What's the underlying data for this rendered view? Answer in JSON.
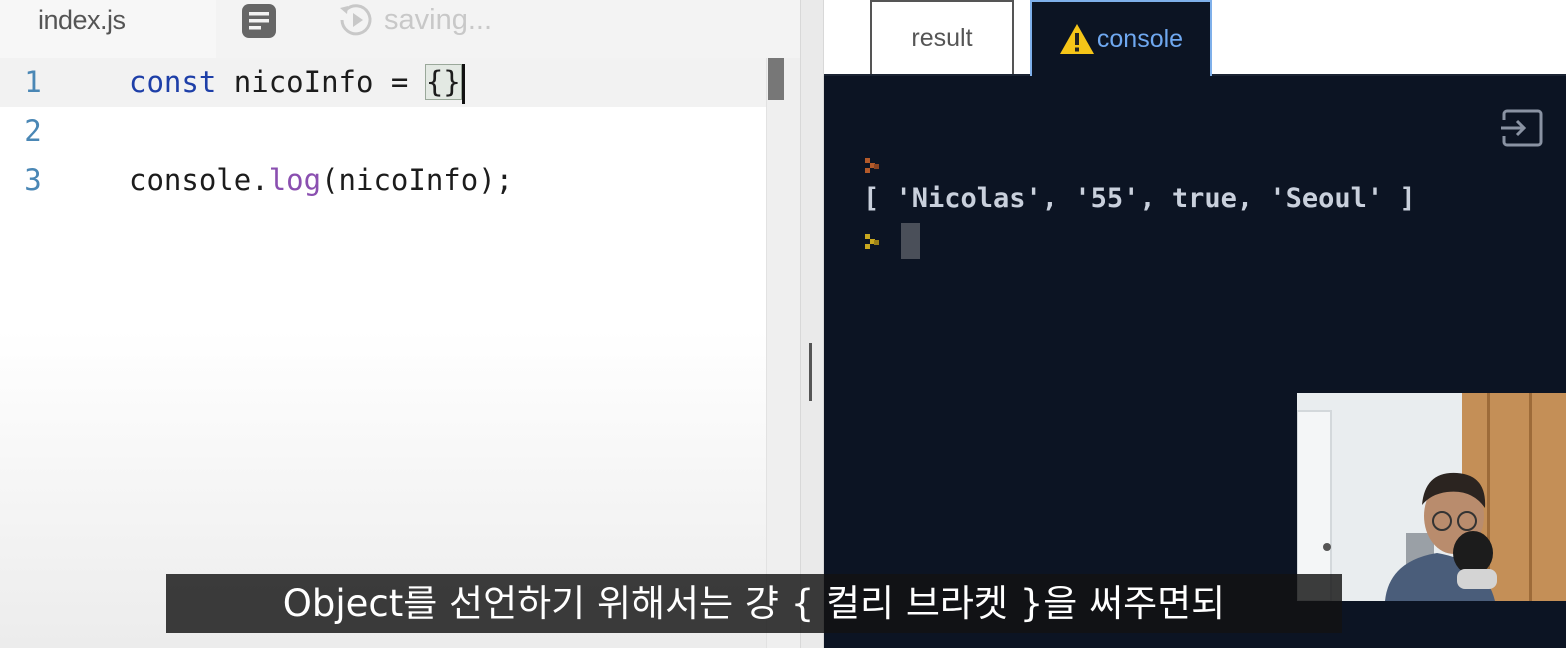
{
  "editor": {
    "file_tab": "index.js",
    "format_button_icon": "format-code-icon",
    "status_icon": "history-icon",
    "status_text": "saving...",
    "lines": [
      {
        "number": "1",
        "text": "const nicoInfo = {}"
      },
      {
        "number": "2",
        "text": ""
      },
      {
        "number": "3",
        "text": "console.log(nicoInfo);"
      }
    ],
    "tokens": {
      "kw_const": "const",
      "var_name": " nicoInfo = ",
      "braces": "{}",
      "console_obj": "console.",
      "log_fn": "log",
      "log_args": "(nicoInfo);"
    }
  },
  "tabs": {
    "result": "result",
    "console": "console",
    "console_warning_icon": "warning-icon"
  },
  "console": {
    "output": "[ 'Nicolas', '55', true, 'Seoul' ]",
    "exit_icon": "exit-fullscreen-icon",
    "colors": {
      "background": "#0c1423",
      "prompt_output": "#b35a2a",
      "prompt_input": "#c9a81f"
    }
  },
  "subtitle": "Object를 선언하기 위해서는 걍 { 컬리 브라켓 }을 써주면되"
}
